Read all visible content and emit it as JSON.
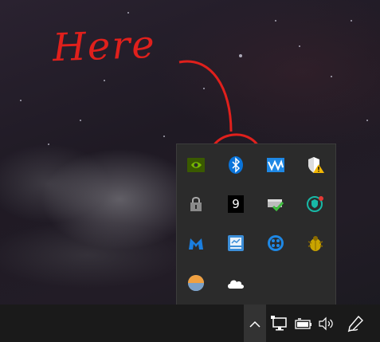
{
  "annotation": {
    "text": "Here"
  },
  "tray": {
    "icons": [
      {
        "name": "nvidia-icon",
        "color": "#76b900"
      },
      {
        "name": "bluetooth-icon",
        "color": "#0a74da"
      },
      {
        "name": "waves-audio-icon",
        "color": "#1e88e5"
      },
      {
        "name": "security-warning-icon",
        "color": "#f2b705"
      },
      {
        "name": "lock-app-icon",
        "color": "#9a9a9a"
      },
      {
        "name": "number-badge-icon",
        "label": "9"
      },
      {
        "name": "drive-check-icon",
        "color": "#3fbf3f"
      },
      {
        "name": "vpn-shield-icon",
        "color": "#18b8a6"
      },
      {
        "name": "malwarebytes-icon",
        "color": "#1a7fe0"
      },
      {
        "name": "network-manager-icon",
        "color": "#3c8ed8"
      },
      {
        "name": "circle-dots-icon",
        "color": "#1e88e5"
      },
      {
        "name": "bug-icon",
        "color": "#c9a400"
      },
      {
        "name": "weather-icon",
        "color": "#f0a040"
      },
      {
        "name": "onedrive-cloud-icon",
        "color": "#ffffff"
      }
    ]
  },
  "taskbar": {
    "items": [
      "chevron-up-icon",
      "network-monitor-icon",
      "battery-icon",
      "volume-icon",
      "pen-icon"
    ]
  },
  "colors": {
    "annotation": "#e0201c",
    "flyout_bg": "#2b2b2b",
    "taskbar_bg": "#1a1a1a"
  }
}
